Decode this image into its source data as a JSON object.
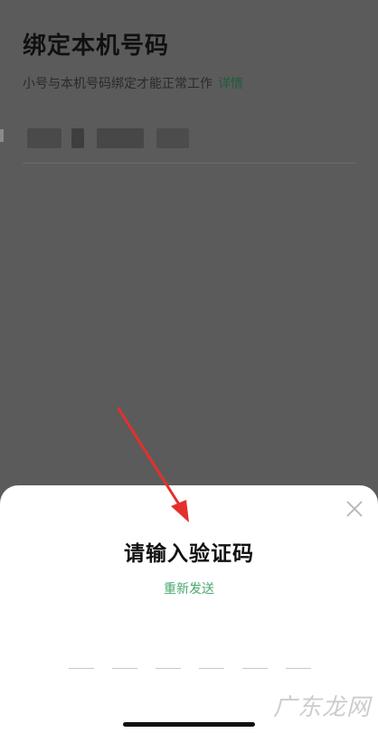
{
  "page": {
    "title": "绑定本机号码",
    "subtitle": "小号与本机号码绑定才能正常工作",
    "details_link": "详情"
  },
  "sheet": {
    "title": "请输入验证码",
    "resend_label": "重新发送",
    "close_icon": "close-icon",
    "code_slots": [
      "",
      "",
      "",
      "",
      "",
      ""
    ]
  },
  "watermark": "广东龙网",
  "colors": {
    "accent_green": "#4aa86f",
    "dark_link_green": "#1f5c3a",
    "arrow_red": "#e4302b",
    "overlay_gray": "#5b5b5b"
  }
}
